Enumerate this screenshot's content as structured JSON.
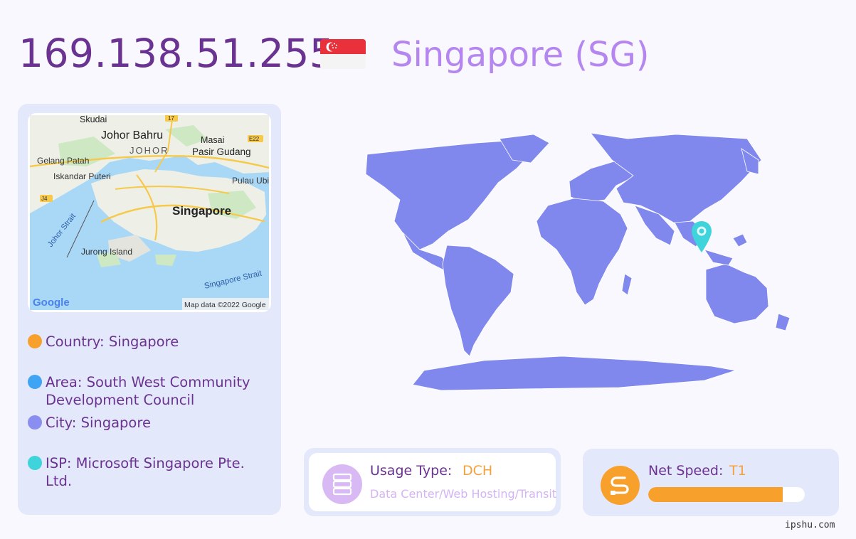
{
  "header": {
    "ip": "169.138.51.255",
    "country_title": "Singapore (SG)",
    "flag_icon": "singapore-flag-icon"
  },
  "map": {
    "labels": {
      "skudai": "Skudai",
      "johor_bahru": "Johor Bahru",
      "masai": "Masai",
      "johor": "JOHOR",
      "pasir_gudang": "Pasir Gudang",
      "gelang_patah": "Gelang Patah",
      "iskandar_puteri": "Iskandar Puteri",
      "pulau_ubin": "Pulau Ubi",
      "singapore": "Singapore",
      "johor_strait": "Johor Strait",
      "jurong_island": "Jurong Island",
      "singapore_strait": "Singapore Strait",
      "road_17": "17",
      "road_e22": "E22",
      "road_j4": "J4"
    },
    "google_logo": "Google",
    "attribution": "Map data ©2022 Google"
  },
  "info": [
    {
      "text": "Country: Singapore",
      "color": "#f7a12c"
    },
    {
      "text": "Area: South West Community Development Council",
      "color": "#3fa4f4"
    },
    {
      "text": "City: Singapore",
      "color": "#8a8ef0"
    },
    {
      "text": "ISP: Microsoft Singapore Pte. Ltd.",
      "color": "#3fd3db"
    }
  ],
  "usage": {
    "label": "Usage Type:",
    "value": "DCH",
    "description": "Data Center/Web Hosting/Transit",
    "icon": "server-stack-icon"
  },
  "speed": {
    "label": "Net Speed:",
    "value": "T1",
    "level_percent": 86,
    "icon": "speed-cable-icon"
  },
  "footer": "ipshu.com",
  "colors": {
    "title": "#6b3391",
    "country": "#b586f0",
    "card_bg": "#e4e8fb",
    "world_fill": "#8088ee",
    "pin": "#3fd3db",
    "accent_orange": "#f7a12c"
  }
}
